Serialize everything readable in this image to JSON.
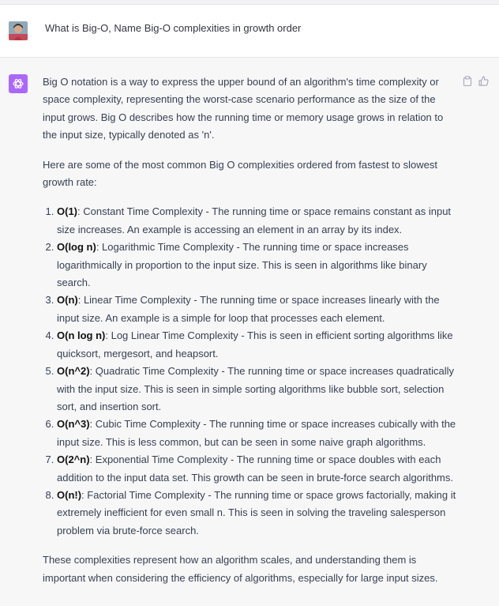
{
  "user": {
    "message": "What is Big-O, Name Big-O complexities in growth order"
  },
  "assistant": {
    "intro": "Big O notation is a way to express the upper bound of an algorithm's time complexity or space complexity, representing the worst-case scenario performance as the size of the input grows. Big O describes how the running time or memory usage grows in relation to the input size, typically denoted as 'n'.",
    "lead": "Here are some of the most common Big O complexities ordered from fastest to slowest growth rate:",
    "items": [
      {
        "term": "O(1)",
        "text": ": Constant Time Complexity - The running time or space remains constant as input size increases. An example is accessing an element in an array by its index."
      },
      {
        "term": "O(log n)",
        "text": ": Logarithmic Time Complexity - The running time or space increases logarithmically in proportion to the input size. This is seen in algorithms like binary search."
      },
      {
        "term": "O(n)",
        "text": ": Linear Time Complexity - The running time or space increases linearly with the input size. An example is a simple for loop that processes each element."
      },
      {
        "term": "O(n log n)",
        "text": ": Log Linear Time Complexity - This is seen in efficient sorting algorithms like quicksort, mergesort, and heapsort."
      },
      {
        "term": "O(n^2)",
        "text": ": Quadratic Time Complexity - The running time or space increases quadratically with the input size. This is seen in simple sorting algorithms like bubble sort, selection sort, and insertion sort."
      },
      {
        "term": "O(n^3)",
        "text": ": Cubic Time Complexity - The running time or space increases cubically with the input size. This is less common, but can be seen in some naive graph algorithms."
      },
      {
        "term": "O(2^n)",
        "text": ": Exponential Time Complexity - The running time or space doubles with each addition to the input data set. This growth can be seen in brute-force search algorithms."
      },
      {
        "term": "O(n!)",
        "text": ": Factorial Time Complexity - The running time or space grows factorially, making it extremely inefficient for even small n. This is seen in solving the traveling salesperson problem via brute-force search."
      }
    ],
    "outro": "These complexities represent how an algorithm scales, and understanding them is important when considering the efficiency of algorithms, especially for large input sizes."
  },
  "icons": {
    "user_avatar": "user-photo-avatar",
    "assistant_avatar": "openai-logo-icon",
    "copy": "clipboard-icon",
    "like": "thumbs-up-icon"
  },
  "colors": {
    "assistant_avatar_bg": "#ab68ff",
    "assistant_bg": "#f7f7f8",
    "text": "#374151"
  }
}
